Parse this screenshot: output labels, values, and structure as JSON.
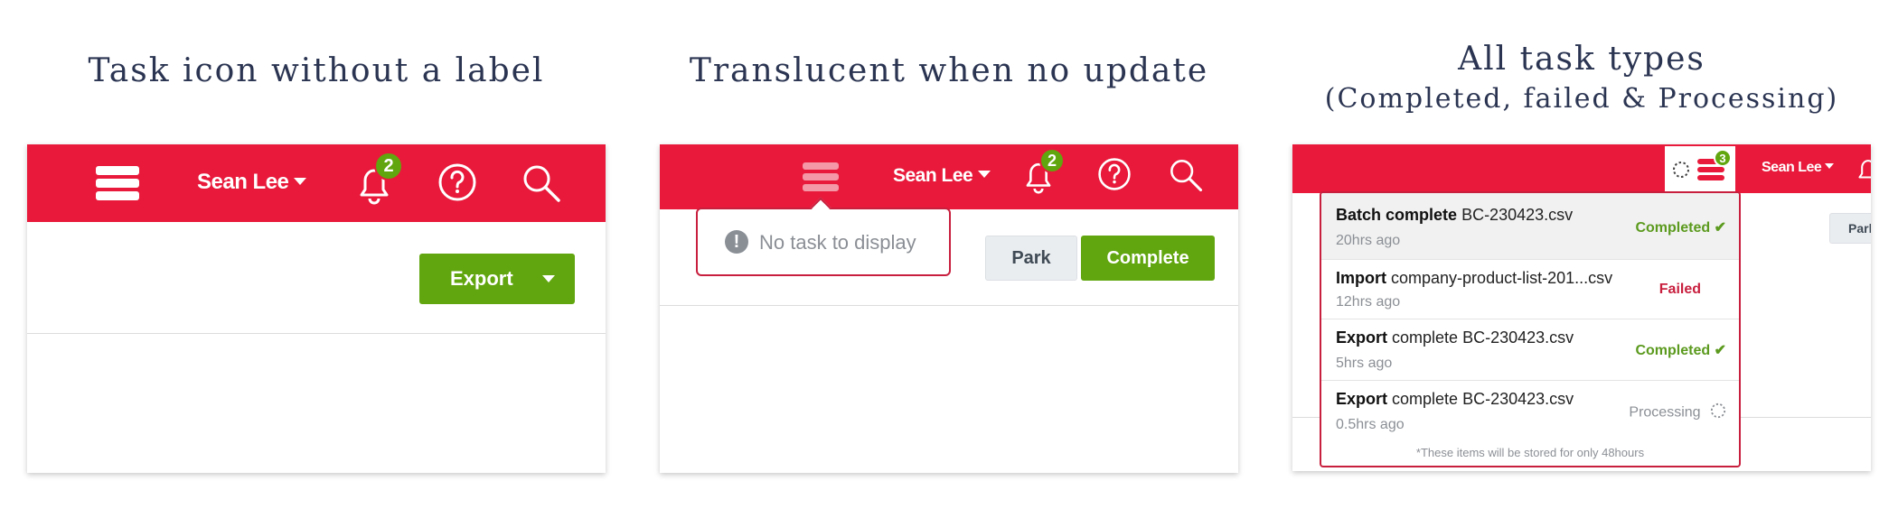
{
  "captions": {
    "panel1": "Task icon without a label",
    "panel2": "Translucent when no update",
    "panel3_line1": "All task types",
    "panel3_line2": "(Completed, failed & Processing)"
  },
  "header": {
    "user_name": "Sean Lee",
    "notification_count": "2",
    "task_count": "3"
  },
  "panel1": {
    "export_label": "Export"
  },
  "panel2": {
    "empty_message": "No task to display",
    "park_label": "Park",
    "complete_label": "Complete"
  },
  "panel3": {
    "park_label_partial": "Park",
    "tasks": [
      {
        "action": "Batch complete",
        "file": "BC-230423.csv",
        "ago": "20hrs ago",
        "status": "Completed"
      },
      {
        "action": "Import",
        "file": "company-product-list-201...csv",
        "ago": "12hrs ago",
        "status": "Failed"
      },
      {
        "action": "Export",
        "file": "complete BC-230423.csv",
        "ago": "5hrs ago",
        "status": "Completed"
      },
      {
        "action": "Export",
        "file": "complete BC-230423.csv",
        "ago": "0.5hrs ago",
        "status": "Processing"
      }
    ],
    "footnote": "*These items will be stored for only 48hours"
  },
  "colors": {
    "header_red": "#e8193a",
    "accent_green": "#61a60e",
    "popover_border": "#c81f3e",
    "caption_navy": "#2b3552"
  },
  "icons": [
    "tasks-icon",
    "bell-icon",
    "help-icon",
    "search-icon",
    "caret-down-icon",
    "warning-icon",
    "check-icon",
    "spinner-icon"
  ]
}
